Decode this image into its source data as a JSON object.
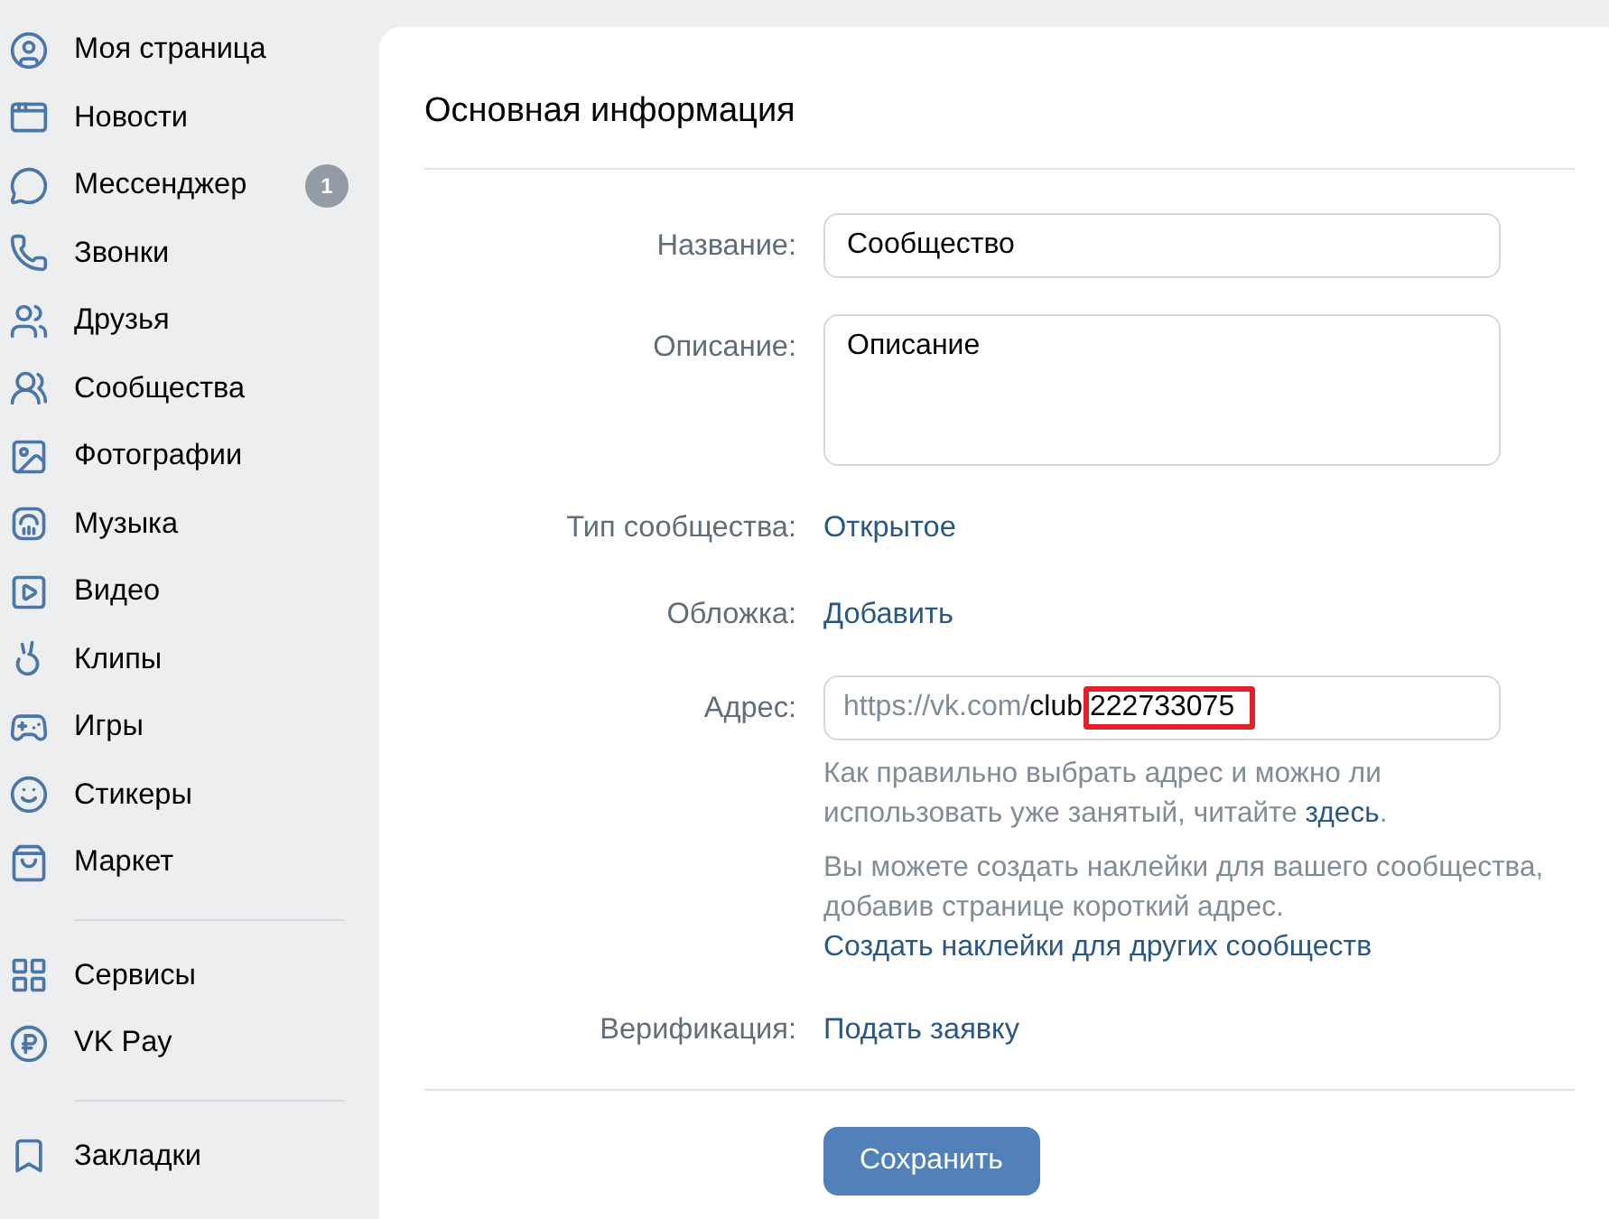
{
  "sidebar": {
    "groups": [
      {
        "items": [
          {
            "label": "Моя страница"
          },
          {
            "label": "Новости"
          },
          {
            "label": "Мессенджер",
            "badge": "1"
          },
          {
            "label": "Звонки"
          },
          {
            "label": "Друзья"
          },
          {
            "label": "Сообщества"
          },
          {
            "label": "Фотографии"
          },
          {
            "label": "Музыка"
          },
          {
            "label": "Видео"
          },
          {
            "label": "Клипы"
          },
          {
            "label": "Игры"
          },
          {
            "label": "Стикеры"
          },
          {
            "label": "Маркет"
          }
        ]
      },
      {
        "items": [
          {
            "label": "Сервисы"
          },
          {
            "label": "VK Pay"
          }
        ]
      },
      {
        "items": [
          {
            "label": "Закладки"
          }
        ]
      }
    ]
  },
  "card": {
    "title": "Основная информация",
    "fields": [
      {
        "kind": "input",
        "label": "Название:",
        "value": "Сообщество"
      },
      {
        "kind": "textarea",
        "label": "Описание:",
        "value": "Описание"
      },
      {
        "kind": "link",
        "label": "Тип сообщества:",
        "value": "Открытое"
      },
      {
        "kind": "link",
        "label": "Обложка:",
        "value": "Добавить"
      },
      {
        "kind": "address",
        "label": "Адрес:",
        "prefix": "https://vk.com/",
        "value": "club",
        "highlighted_value": "222733075",
        "notes": [
          {
            "text": "Как правильно выбрать адрес и можно ли использовать уже занятый, читайте ",
            "link": "здесь",
            "after": "."
          },
          {
            "text": "Вы можете создать наклейки для вашего сообщества, добавив странице короткий адрес."
          }
        ],
        "action_link": "Создать наклейки для других сообществ"
      },
      {
        "kind": "link",
        "label": "Верификация:",
        "value": "Подать заявку"
      }
    ],
    "save_button": "Сохранить"
  }
}
